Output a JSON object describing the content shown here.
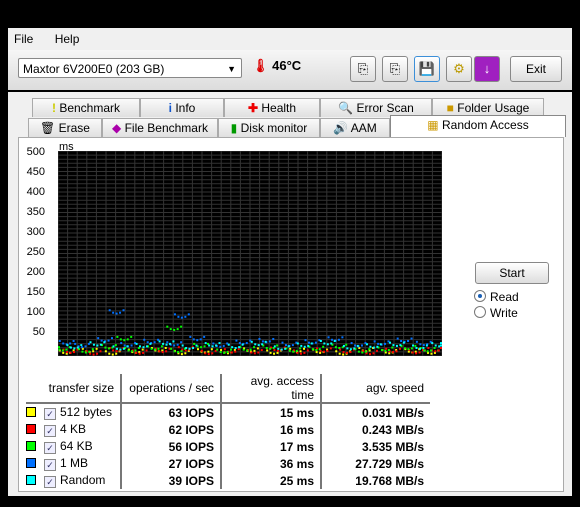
{
  "menu": [
    "File",
    "Help"
  ],
  "toolbar": {
    "drive": "Maxtor 6V200E0 (203 GB)",
    "temperature": "46°C",
    "exit": "Exit"
  },
  "tabs_row1": [
    "Benchmark",
    "Info",
    "Health",
    "Error Scan",
    "Folder Usage"
  ],
  "tabs_row2": [
    "Erase",
    "File Benchmark",
    "Disk monitor",
    "AAM",
    "Random Access"
  ],
  "controls": {
    "start": "Start",
    "read": "Read",
    "write": "Write",
    "mode": "Read"
  },
  "table": {
    "headers": [
      "transfer size",
      "operations / sec",
      "avg. access time",
      "agv. speed"
    ],
    "rows": [
      {
        "color": "#ffff00",
        "size": "512 bytes",
        "ops": "63 IOPS",
        "time": "15 ms",
        "speed": "0.031 MB/s"
      },
      {
        "color": "#ff0000",
        "size": "4 KB",
        "ops": "62 IOPS",
        "time": "16 ms",
        "speed": "0.243 MB/s"
      },
      {
        "color": "#00ff00",
        "size": "64 KB",
        "ops": "56 IOPS",
        "time": "17 ms",
        "speed": "3.535 MB/s"
      },
      {
        "color": "#0070ff",
        "size": "1 MB",
        "ops": "27 IOPS",
        "time": "36 ms",
        "speed": "27.729 MB/s"
      },
      {
        "color": "#00ffff",
        "size": "Random",
        "ops": "39 IOPS",
        "time": "25 ms",
        "speed": "19.768 MB/s"
      }
    ]
  },
  "chart_data": {
    "type": "scatter",
    "ylabel": "ms",
    "ylim": [
      0,
      500
    ],
    "xlim": [
      0,
      100
    ],
    "yticks": [
      "500",
      "450",
      "400",
      "350",
      "300",
      "250",
      "200",
      "150",
      "100",
      "50"
    ],
    "xticks": [
      "0",
      "10",
      "20",
      "30",
      "40",
      "50",
      "60",
      "70",
      "80",
      "90",
      "100%"
    ],
    "grid": true,
    "background": "#000000",
    "series": [
      {
        "color": "#ffff00",
        "points": [
          [
            2,
            12
          ],
          [
            8,
            16
          ],
          [
            14,
            10
          ],
          [
            20,
            14
          ],
          [
            26,
            18
          ],
          [
            32,
            11
          ],
          [
            38,
            15
          ],
          [
            44,
            13
          ],
          [
            50,
            17
          ],
          [
            56,
            12
          ],
          [
            62,
            16
          ],
          [
            68,
            14
          ],
          [
            74,
            10
          ],
          [
            80,
            18
          ],
          [
            86,
            13
          ],
          [
            92,
            15
          ],
          [
            97,
            12
          ]
        ]
      },
      {
        "color": "#ff0000",
        "points": [
          [
            3,
            14
          ],
          [
            9,
            10
          ],
          [
            15,
            18
          ],
          [
            21,
            12
          ],
          [
            27,
            16
          ],
          [
            33,
            20
          ],
          [
            39,
            11
          ],
          [
            45,
            15
          ],
          [
            51,
            13
          ],
          [
            57,
            19
          ],
          [
            63,
            12
          ],
          [
            69,
            17
          ],
          [
            75,
            14
          ],
          [
            81,
            11
          ],
          [
            87,
            16
          ],
          [
            93,
            13
          ],
          [
            98,
            18
          ]
        ]
      },
      {
        "color": "#00ff00",
        "points": [
          [
            1,
            20
          ],
          [
            7,
            15
          ],
          [
            13,
            25
          ],
          [
            19,
            18
          ],
          [
            25,
            22
          ],
          [
            31,
            16
          ],
          [
            37,
            28
          ],
          [
            43,
            14
          ],
          [
            49,
            20
          ],
          [
            55,
            24
          ],
          [
            61,
            17
          ],
          [
            67,
            21
          ],
          [
            73,
            26
          ],
          [
            79,
            15
          ],
          [
            85,
            19
          ],
          [
            91,
            23
          ],
          [
            96,
            18
          ],
          [
            30,
            70
          ],
          [
            17,
            45
          ]
        ]
      },
      {
        "color": "#0070ff",
        "points": [
          [
            2,
            35
          ],
          [
            6,
            28
          ],
          [
            12,
            42
          ],
          [
            18,
            30
          ],
          [
            24,
            38
          ],
          [
            30,
            32
          ],
          [
            36,
            45
          ],
          [
            42,
            29
          ],
          [
            48,
            36
          ],
          [
            54,
            40
          ],
          [
            60,
            31
          ],
          [
            66,
            37
          ],
          [
            72,
            44
          ],
          [
            78,
            30
          ],
          [
            84,
            34
          ],
          [
            90,
            41
          ],
          [
            95,
            33
          ],
          [
            15,
            110
          ],
          [
            32,
            100
          ]
        ]
      },
      {
        "color": "#00ffff",
        "points": [
          [
            4,
            25
          ],
          [
            10,
            32
          ],
          [
            16,
            22
          ],
          [
            22,
            28
          ],
          [
            28,
            34
          ],
          [
            34,
            24
          ],
          [
            40,
            30
          ],
          [
            46,
            26
          ],
          [
            52,
            33
          ],
          [
            58,
            22
          ],
          [
            64,
            29
          ],
          [
            70,
            35
          ],
          [
            76,
            23
          ],
          [
            82,
            27
          ],
          [
            88,
            31
          ],
          [
            94,
            24
          ],
          [
            99,
            30
          ]
        ]
      }
    ]
  }
}
